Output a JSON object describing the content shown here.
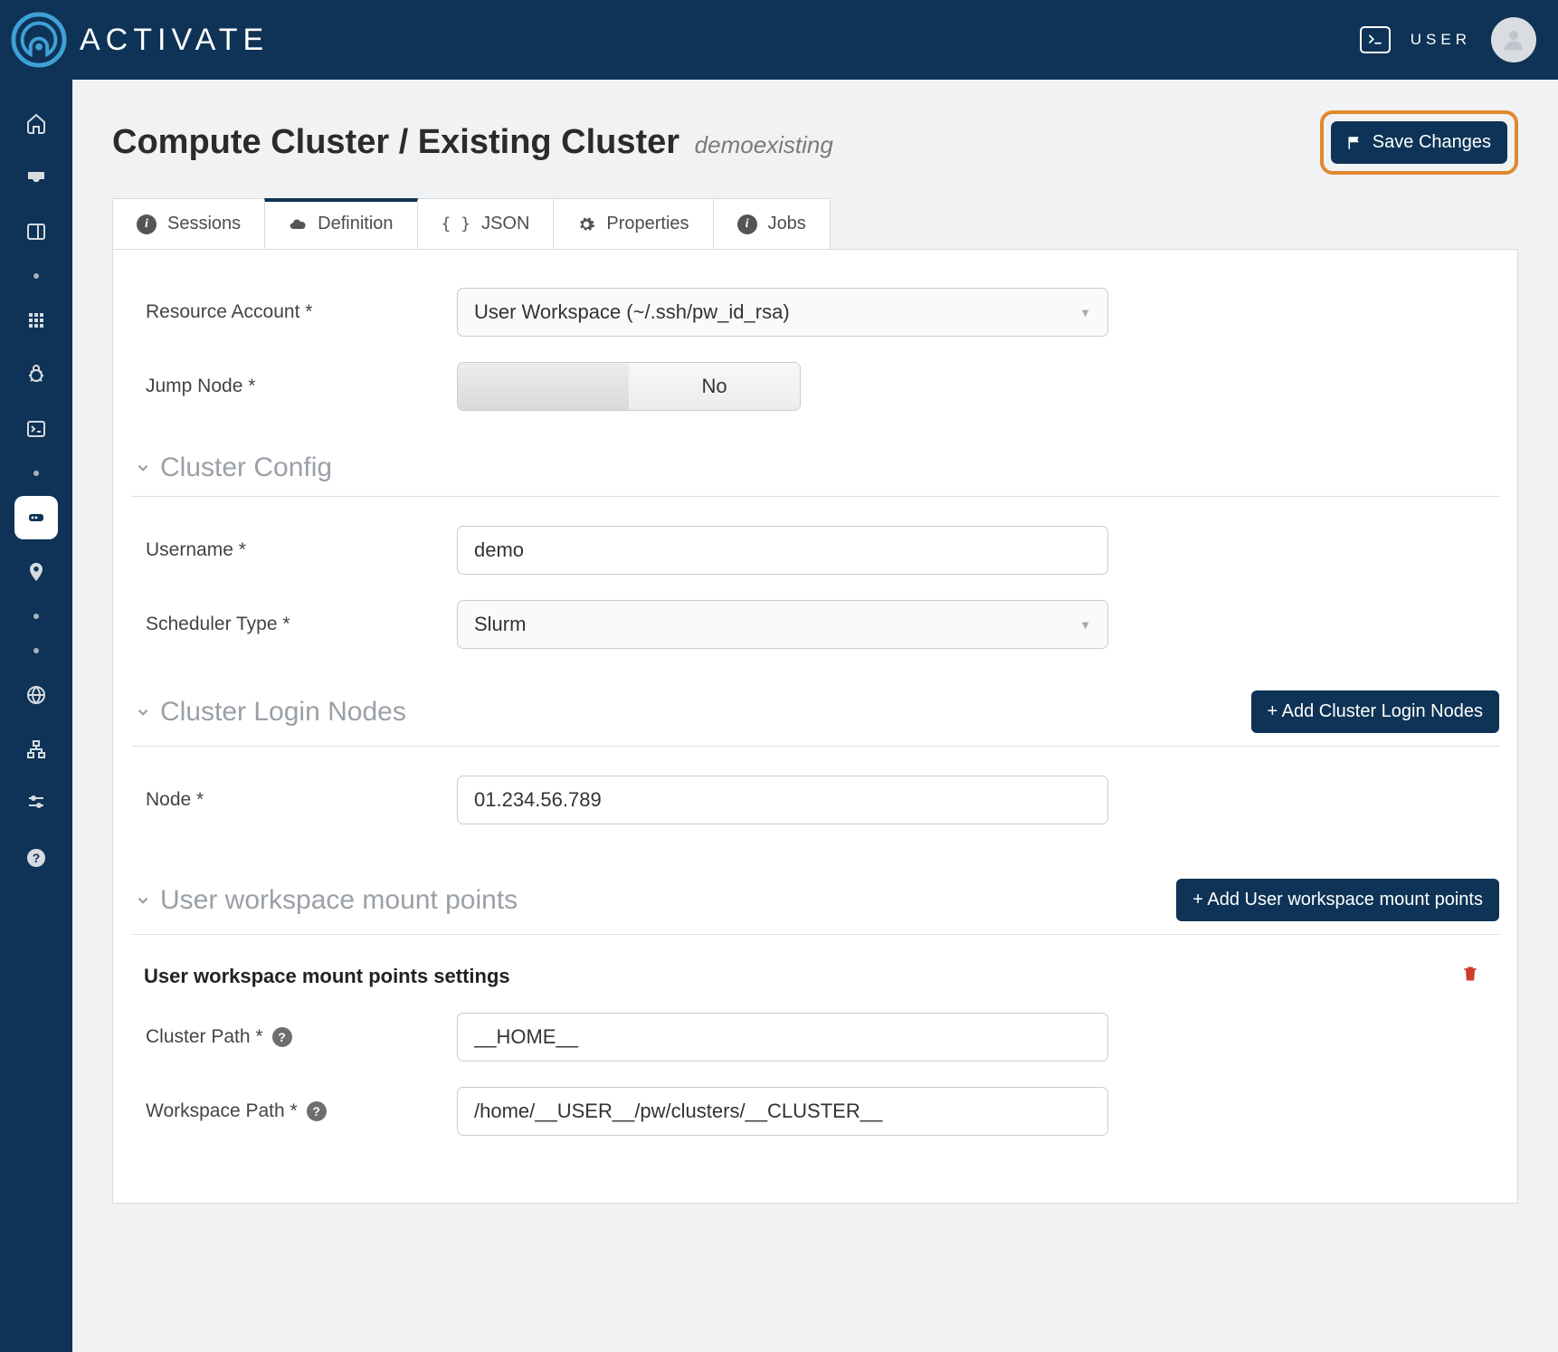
{
  "brand": "ACTIVATE",
  "topbar": {
    "user_label": "USER"
  },
  "page": {
    "title_prefix": "Compute Cluster / Existing Cluster",
    "slug": "demoexisting",
    "save_label": "Save Changes"
  },
  "tabs": [
    {
      "id": "sessions",
      "label": "Sessions",
      "icon": "info"
    },
    {
      "id": "definition",
      "label": "Definition",
      "icon": "cloud"
    },
    {
      "id": "json",
      "label": "JSON",
      "icon": "braces"
    },
    {
      "id": "properties",
      "label": "Properties",
      "icon": "gear"
    },
    {
      "id": "jobs",
      "label": "Jobs",
      "icon": "info"
    }
  ],
  "active_tab": "definition",
  "form": {
    "resource_account_label": "Resource Account *",
    "resource_account_value": "User Workspace (~/.ssh/pw_id_rsa)",
    "jump_node_label": "Jump Node *",
    "jump_node_value": "No",
    "cluster_config_heading": "Cluster Config",
    "username_label": "Username *",
    "username_value": "demo",
    "scheduler_label": "Scheduler Type *",
    "scheduler_value": "Slurm",
    "login_nodes_heading": "Cluster Login Nodes",
    "add_login_nodes_label": "+ Add Cluster Login Nodes",
    "node_label": "Node *",
    "node_value": "01.234.56.789",
    "mounts_heading": "User workspace mount points",
    "add_mounts_label": "+ Add User workspace mount points",
    "mounts_sub_heading": "User workspace mount points settings",
    "cluster_path_label": "Cluster Path *",
    "cluster_path_value": "__HOME__",
    "workspace_path_label": "Workspace Path *",
    "workspace_path_value": "/home/__USER__/pw/clusters/__CLUSTER__"
  }
}
